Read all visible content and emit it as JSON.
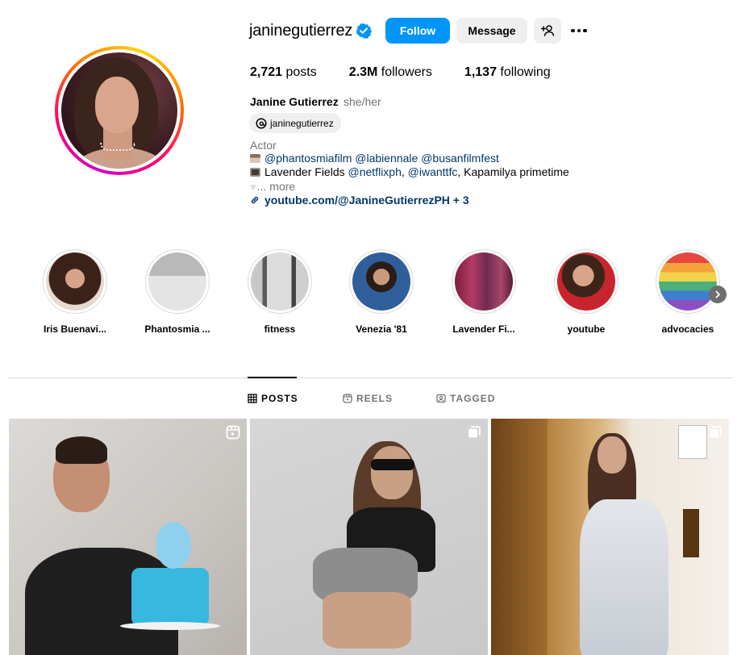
{
  "profile": {
    "username": "janinegutierrez",
    "follow_label": "Follow",
    "message_label": "Message",
    "stats": {
      "posts_count": "2,721",
      "posts_label": "posts",
      "followers_count": "2.3M",
      "followers_label": "followers",
      "following_count": "1,137",
      "following_label": "following"
    },
    "full_name": "Janine Gutierrez",
    "pronouns": "she/her",
    "threads_handle": "janinegutierrez",
    "category": "Actor",
    "bio": {
      "line1_mention1": "@phantosmiafilm",
      "line1_mention2": "@labiennale",
      "line1_mention3": "@busanfilmfest",
      "line2_text1": "Lavender Fields",
      "line2_mention1": "@netflixph",
      "line2_sep": ",",
      "line2_mention2": "@iwanttfc",
      "line2_text2": ", Kapamilya primetime",
      "more": "... more"
    },
    "link": "youtube.com/@JanineGutierrezPH + 3"
  },
  "highlights": [
    {
      "label": "Iris Buenavi..."
    },
    {
      "label": "Phantosmia ..."
    },
    {
      "label": "fitness"
    },
    {
      "label": "Venezia '81"
    },
    {
      "label": "Lavender Fi..."
    },
    {
      "label": "youtube"
    },
    {
      "label": "advocacies"
    }
  ],
  "tabs": [
    {
      "label": "POSTS",
      "icon": "grid-icon",
      "active": true
    },
    {
      "label": "REELS",
      "icon": "reels-icon",
      "active": false
    },
    {
      "label": "TAGGED",
      "icon": "tagged-icon",
      "active": false
    }
  ],
  "posts": [
    {
      "type": "reel",
      "icon": "reel-icon"
    },
    {
      "type": "carousel",
      "icon": "carousel-icon"
    },
    {
      "type": "carousel",
      "icon": "carousel-icon"
    }
  ],
  "colors": {
    "accent": "#0095f6",
    "link": "#00376b",
    "muted": "#737373",
    "button_gray": "#efefef"
  }
}
